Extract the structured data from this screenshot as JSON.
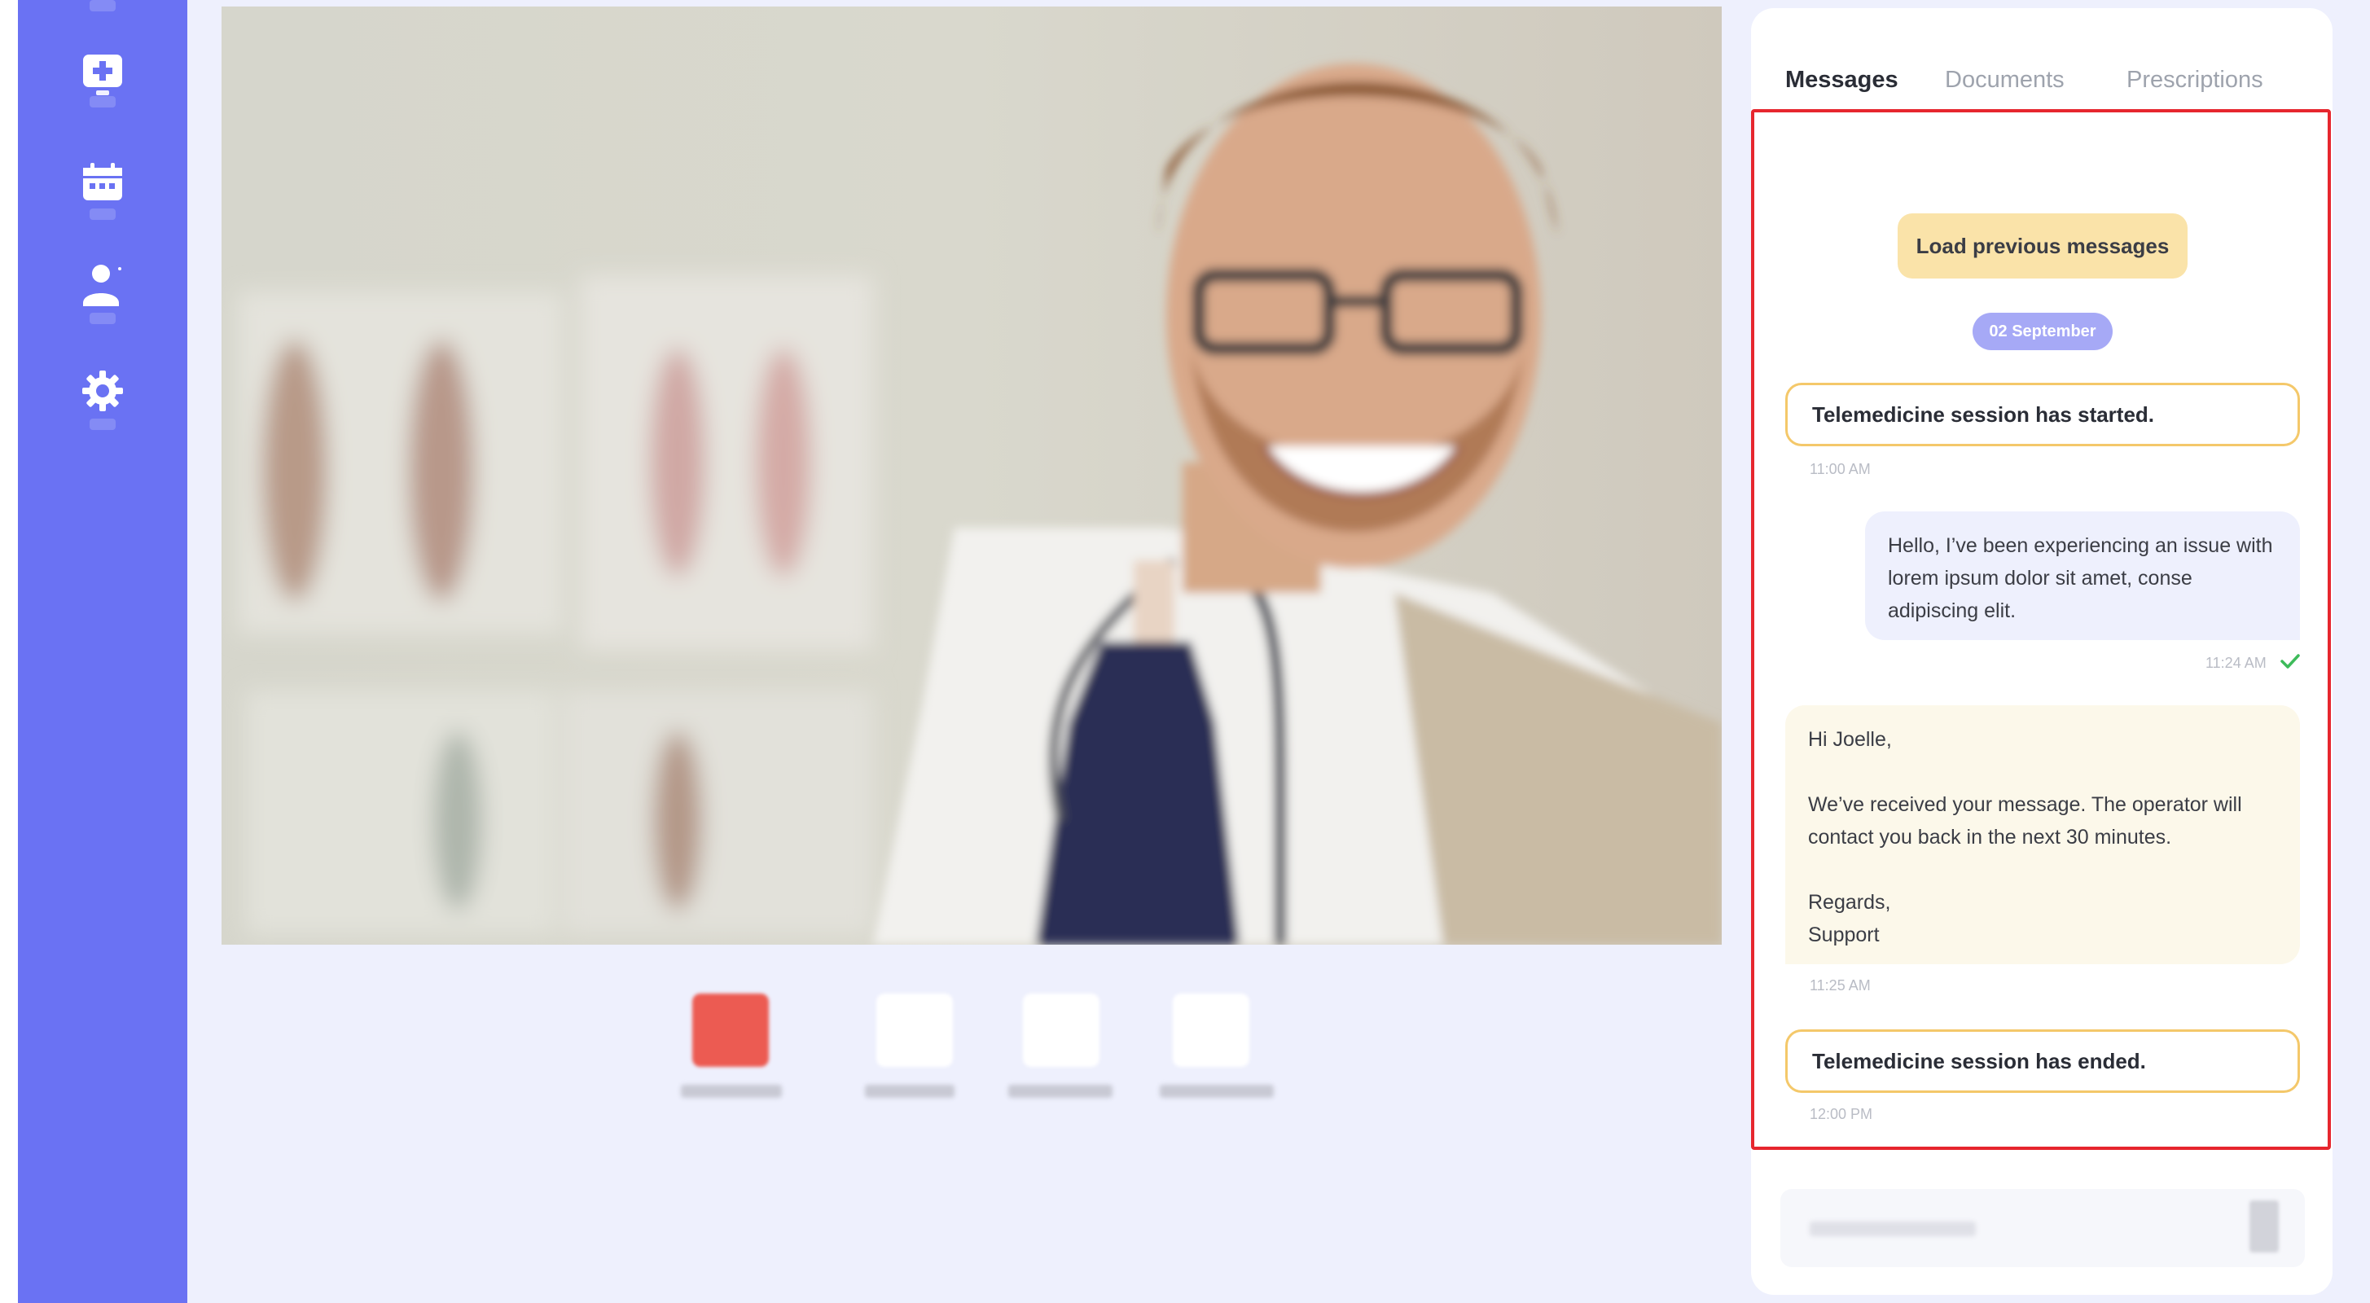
{
  "sidebar": {
    "items": [
      {
        "name": "telemedicine",
        "icon": "monitor-plus-icon"
      },
      {
        "name": "calendar",
        "icon": "calendar-icon"
      },
      {
        "name": "profile",
        "icon": "user-icon"
      },
      {
        "name": "settings",
        "icon": "gear-icon"
      }
    ],
    "color": "#6a72f3"
  },
  "video": {
    "subject": "doctor-video-feed"
  },
  "controls": [
    {
      "name": "end-call",
      "icon": "hang-up-icon",
      "color": "#ec5b52"
    },
    {
      "name": "mute",
      "icon": "microphone-icon"
    },
    {
      "name": "camera",
      "icon": "camera-icon"
    },
    {
      "name": "fullscreen",
      "icon": "expand-icon"
    }
  ],
  "tabs": [
    {
      "label": "Messages",
      "active": true
    },
    {
      "label": "Documents",
      "active": false
    },
    {
      "label": "Prescriptions",
      "active": false
    }
  ],
  "chat": {
    "load_previous": "Load previous messages",
    "date": "02 September",
    "messages": [
      {
        "type": "system",
        "text": "Telemedicine session has started.",
        "time": "11:00 AM"
      },
      {
        "type": "outgoing",
        "text": "Hello, I’ve been experiencing an issue with lorem ipsum dolor sit amet, conse adipiscing elit.",
        "time": "11:24 AM",
        "status": "read"
      },
      {
        "type": "incoming",
        "lines": [
          "Hi Joelle,",
          "We’ve received your message. The operator will contact you back in the next 30 minutes.",
          "Regards,",
          "Support"
        ],
        "time": "11:25 AM"
      },
      {
        "type": "system",
        "text": "Telemedicine session has ended.",
        "time": "12:00 PM"
      }
    ]
  },
  "colors": {
    "accent": "#6a72f3",
    "highlight_border": "#e6262e",
    "system_border": "#f4c86a",
    "load_button": "#fae3a9",
    "date_pill": "#a6a9f6"
  }
}
